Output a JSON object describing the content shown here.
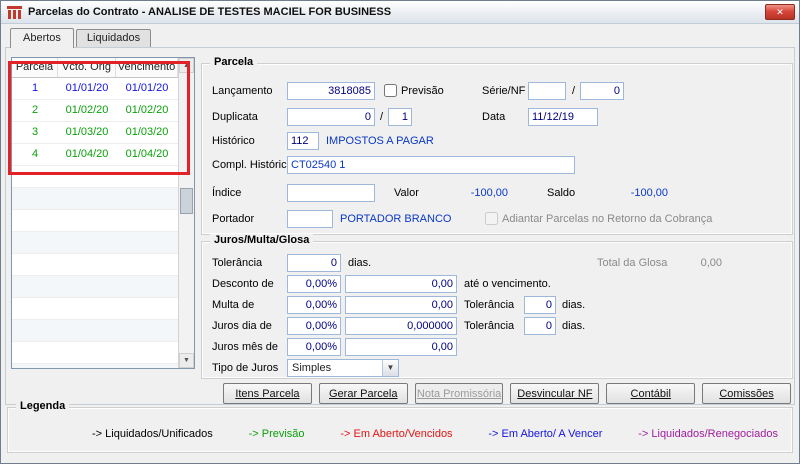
{
  "window": {
    "title": "Parcelas do Contrato - ANALISE DE TESTES MACIEL FOR BUSINESS",
    "close_glyph": "✕"
  },
  "tabs": [
    {
      "label": "Abertos"
    },
    {
      "label": "Liquidados"
    }
  ],
  "grid": {
    "columns": [
      "Parcela",
      "Vcto. Orig",
      "Vencimento"
    ],
    "rows": [
      {
        "parcela": "1",
        "vcto_orig": "01/01/20",
        "vencimento": "01/01/20",
        "color": "#1414e0"
      },
      {
        "parcela": "2",
        "vcto_orig": "01/02/20",
        "vencimento": "01/02/20",
        "color": "#0ba00b"
      },
      {
        "parcela": "3",
        "vcto_orig": "01/03/20",
        "vencimento": "01/03/20",
        "color": "#0ba00b"
      },
      {
        "parcela": "4",
        "vcto_orig": "01/04/20",
        "vencimento": "01/04/20",
        "color": "#0ba00b"
      }
    ],
    "scroll_up_glyph": "▲",
    "scroll_down_glyph": "▼"
  },
  "parcela": {
    "title": "Parcela",
    "lancamento": {
      "label": "Lançamento",
      "value": "3818085"
    },
    "previsao": {
      "label": "Previsão"
    },
    "serie_nf": {
      "label": "Série/NF",
      "serie": "",
      "separator": "/",
      "nf": "0"
    },
    "duplicata": {
      "label": "Duplicata",
      "value": "0",
      "separator": "/",
      "seq": "1"
    },
    "data": {
      "label": "Data",
      "value": "11/12/19"
    },
    "historico": {
      "label": "Histórico",
      "code": "112",
      "descricao": "IMPOSTOS A PAGAR"
    },
    "compl_historico": {
      "label": "Compl. Histórico",
      "value": "CT02540 1"
    },
    "indice": {
      "label": "Índice",
      "value": ""
    },
    "valor": {
      "label": "Valor",
      "value": "-100,00"
    },
    "saldo": {
      "label": "Saldo",
      "value": "-100,00"
    },
    "portador": {
      "label": "Portador",
      "value": "",
      "descricao": "PORTADOR BRANCO"
    },
    "adiantar": {
      "label": "Adiantar Parcelas no Retorno da Cobrança"
    }
  },
  "juros": {
    "title": "Juros/Multa/Glosa",
    "tolerancia": {
      "label": "Tolerância",
      "value": "0",
      "suffix": "dias."
    },
    "total_glosa": {
      "label": "Total da Glosa",
      "value": "0,00"
    },
    "desconto": {
      "label": "Desconto de",
      "percent": "0,00%",
      "value": "0,00",
      "suffix": "até o vencimento."
    },
    "multa": {
      "label": "Multa de",
      "percent": "0,00%",
      "value": "0,00",
      "tolerancia_label": "Tolerância",
      "tolerancia": "0",
      "suffix": "dias."
    },
    "juros_dia": {
      "label": "Juros dia de",
      "percent": "0,00%",
      "value": "0,000000",
      "tolerancia_label": "Tolerância",
      "tolerancia": "0",
      "suffix": "dias."
    },
    "juros_mes": {
      "label": "Juros mês de",
      "percent": "0,00%",
      "value": "0,00"
    },
    "tipo_juros": {
      "label": "Tipo de Juros",
      "value": "Simples",
      "arrow_glyph": "▼"
    }
  },
  "buttons": [
    {
      "label": "Itens Parcela",
      "enabled": true
    },
    {
      "label": "Gerar Parcela",
      "enabled": true
    },
    {
      "label": "Nota Promissória",
      "enabled": false
    },
    {
      "label": "Desvincular NF",
      "enabled": true
    },
    {
      "label": "Contábil",
      "enabled": true
    },
    {
      "label": "Comissões",
      "enabled": true
    }
  ],
  "legend": {
    "title": "Legenda",
    "items": [
      {
        "label": "-> Liquidados/Unificados",
        "color": "#000000"
      },
      {
        "label": "-> Previsão",
        "color": "#0ba00b"
      },
      {
        "label": "-> Em Aberto/Vencidos",
        "color": "#e01616"
      },
      {
        "label": "-> Em Aberto/ A Vencer",
        "color": "#1414e0"
      },
      {
        "label": "-> Liquidados/Renegociados",
        "color": "#a020a0"
      }
    ]
  }
}
